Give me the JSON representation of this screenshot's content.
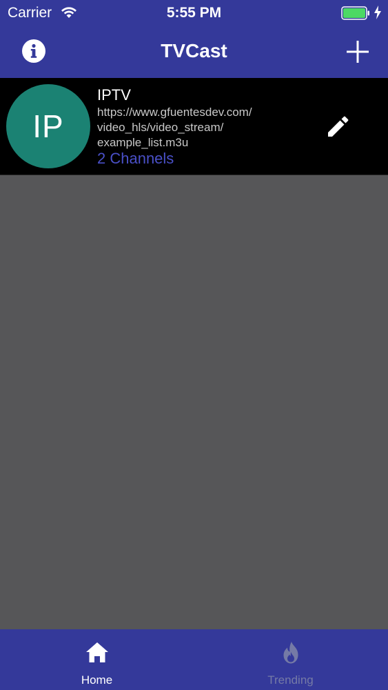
{
  "status_bar": {
    "carrier": "Carrier",
    "time": "5:55 PM",
    "battery_color": "#4cd964"
  },
  "nav": {
    "title": "TVCast",
    "left_icon": "info-icon",
    "right_icon": "plus-icon"
  },
  "playlists": [
    {
      "avatar_text": "IP",
      "avatar_color": "#1b8273",
      "title": "IPTV",
      "url_lines": [
        "https://www.gfuentesdev.com/",
        "video_hls/video_stream/",
        "example_list.m3u"
      ],
      "channels": "2 Channels",
      "action_icon": "pencil-icon"
    }
  ],
  "tabs": [
    {
      "label": "Home",
      "icon": "home-icon",
      "active": true
    },
    {
      "label": "Trending",
      "icon": "flame-icon",
      "active": false
    }
  ],
  "colors": {
    "header": "#34399a",
    "background": "#565658",
    "list_item": "#000000",
    "channels_text": "#4a50c8",
    "tab_inactive": "#757aa6"
  }
}
